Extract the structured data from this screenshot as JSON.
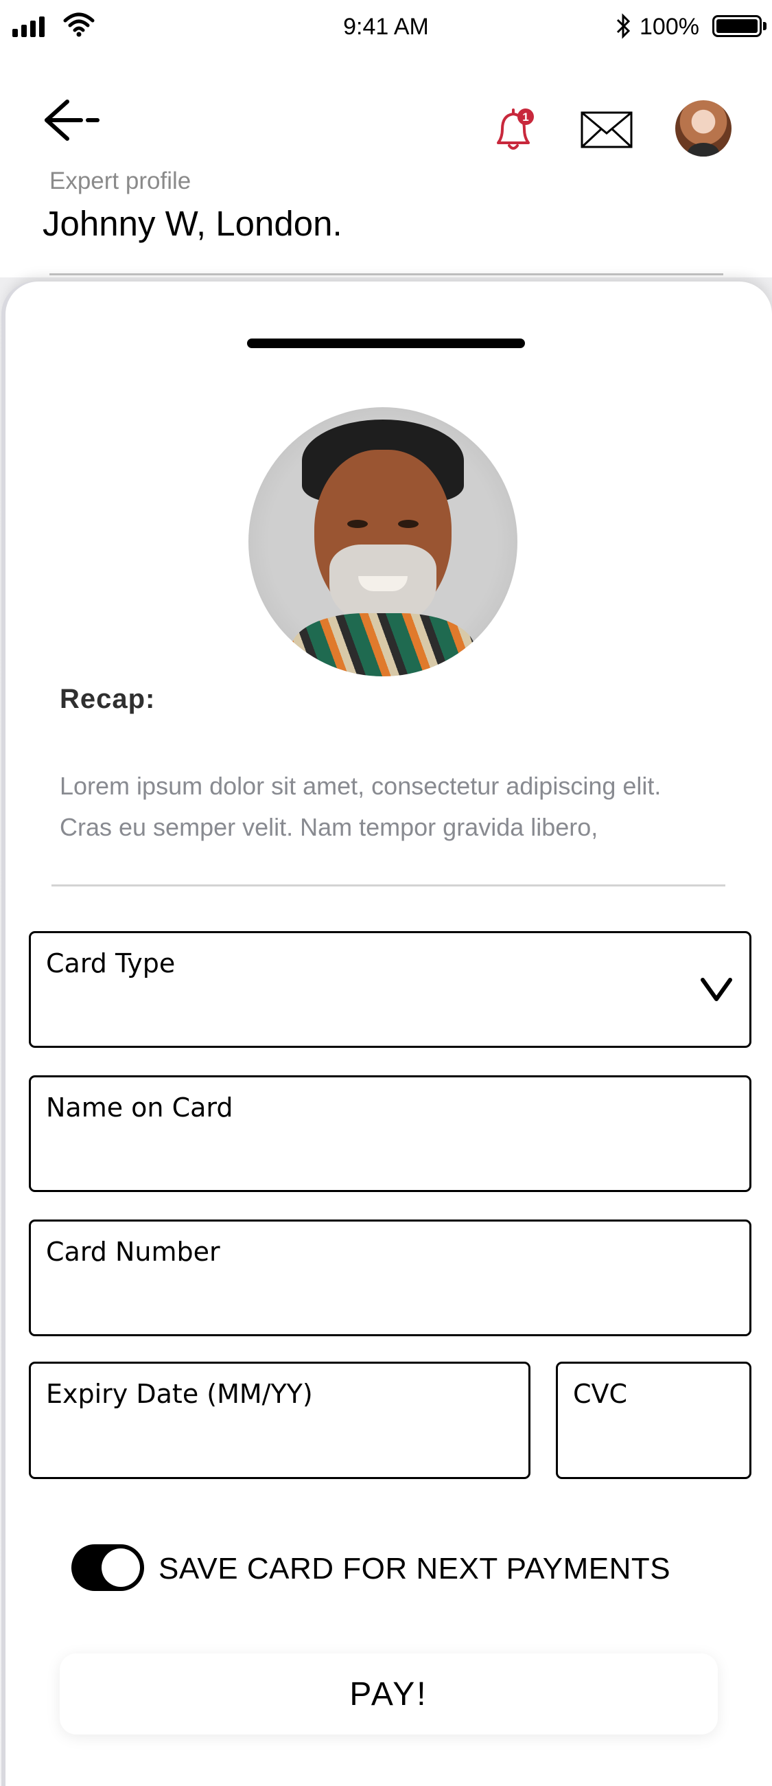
{
  "status_bar": {
    "time": "9:41 AM",
    "battery": "100%",
    "icons": [
      "signal-icon",
      "wifi-icon",
      "bluetooth-icon",
      "battery-icon"
    ]
  },
  "header": {
    "subtitle": "Expert profile",
    "title": "Johnny W, London.",
    "notification_badge": "1",
    "icons": [
      "back-arrow-icon",
      "bell-icon",
      "mail-icon"
    ],
    "colors": {
      "bell": "#c8283c"
    }
  },
  "recap": {
    "title": "Recap:",
    "text": "Lorem ipsum dolor sit amet, consectetur adipiscing elit. Cras eu semper velit. Nam tempor gravida libero,"
  },
  "form": {
    "card_type_label": "Card Type",
    "name_label": "Name on Card",
    "number_label": "Card Number",
    "expiry_label": "Expiry Date (MM/YY)",
    "cvc_label": "CVC"
  },
  "save_card": {
    "label": "SAVE CARD FOR NEXT PAYMENTS",
    "enabled": true
  },
  "pay_button": "PAY!"
}
